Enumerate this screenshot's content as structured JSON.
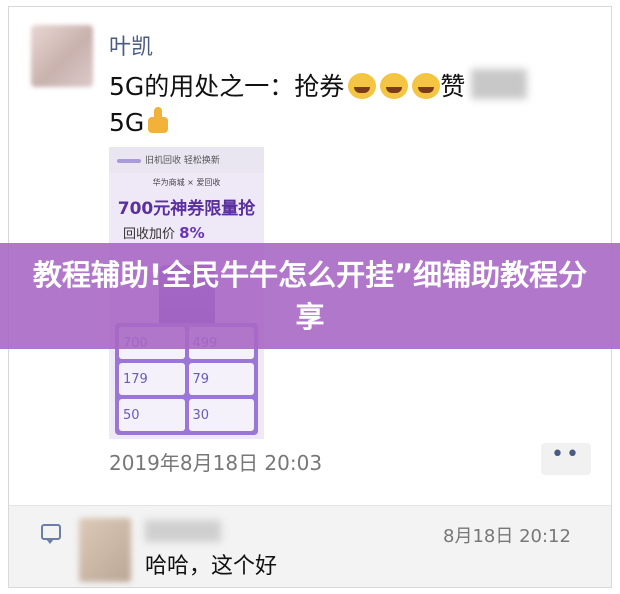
{
  "post": {
    "author": "叶凯",
    "text_prefix": "5G的用处之一：抢券",
    "text_suffix": "赞",
    "text_line2": "5G",
    "emojis": [
      "laughing-tears-emoji",
      "laughing-tears-emoji",
      "laughing-tears-emoji"
    ],
    "thumb_emoji": "thumbs-up-emoji",
    "date": "2019年8月18日 20:03",
    "more_label": "••"
  },
  "ad": {
    "top_text": "旧机回收 轻松换新",
    "brand_text": "华为商城 × 爱回收",
    "headline": "700元神券限量抢",
    "sub_text": "回收加价",
    "pct": "8%",
    "tiles": [
      "700",
      "499",
      "179",
      "79",
      "50",
      "30"
    ]
  },
  "comment": {
    "time": "8月18日 20:12",
    "text": "哈哈，这个好"
  },
  "banner": {
    "title": "教程辅助!全民牛牛怎么开挂”细辅助教程分享"
  },
  "colors": {
    "banner_bg": "#a868c4",
    "author_link": "#4a5c82",
    "ad_accent": "#6a36b8"
  }
}
